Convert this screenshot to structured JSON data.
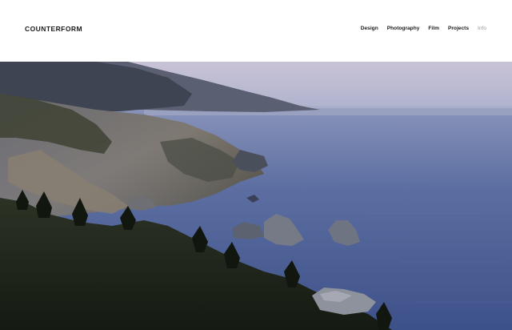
{
  "site": {
    "logo": "COUNTERFORM"
  },
  "nav": {
    "items": [
      {
        "label": "Design",
        "active": false
      },
      {
        "label": "Photography",
        "active": false
      },
      {
        "label": "Film",
        "active": false
      },
      {
        "label": "Projects",
        "active": false
      },
      {
        "label": "Info",
        "active": true
      }
    ]
  },
  "hero": {
    "image": "coastal-cliffs-ocean-dusk-photo"
  },
  "colors": {
    "text": "#1c1c1c",
    "muted": "#9a9a9a",
    "sky": "#b8b7cf",
    "ocean": "#4a5f93",
    "cliff": "#2f3424"
  }
}
